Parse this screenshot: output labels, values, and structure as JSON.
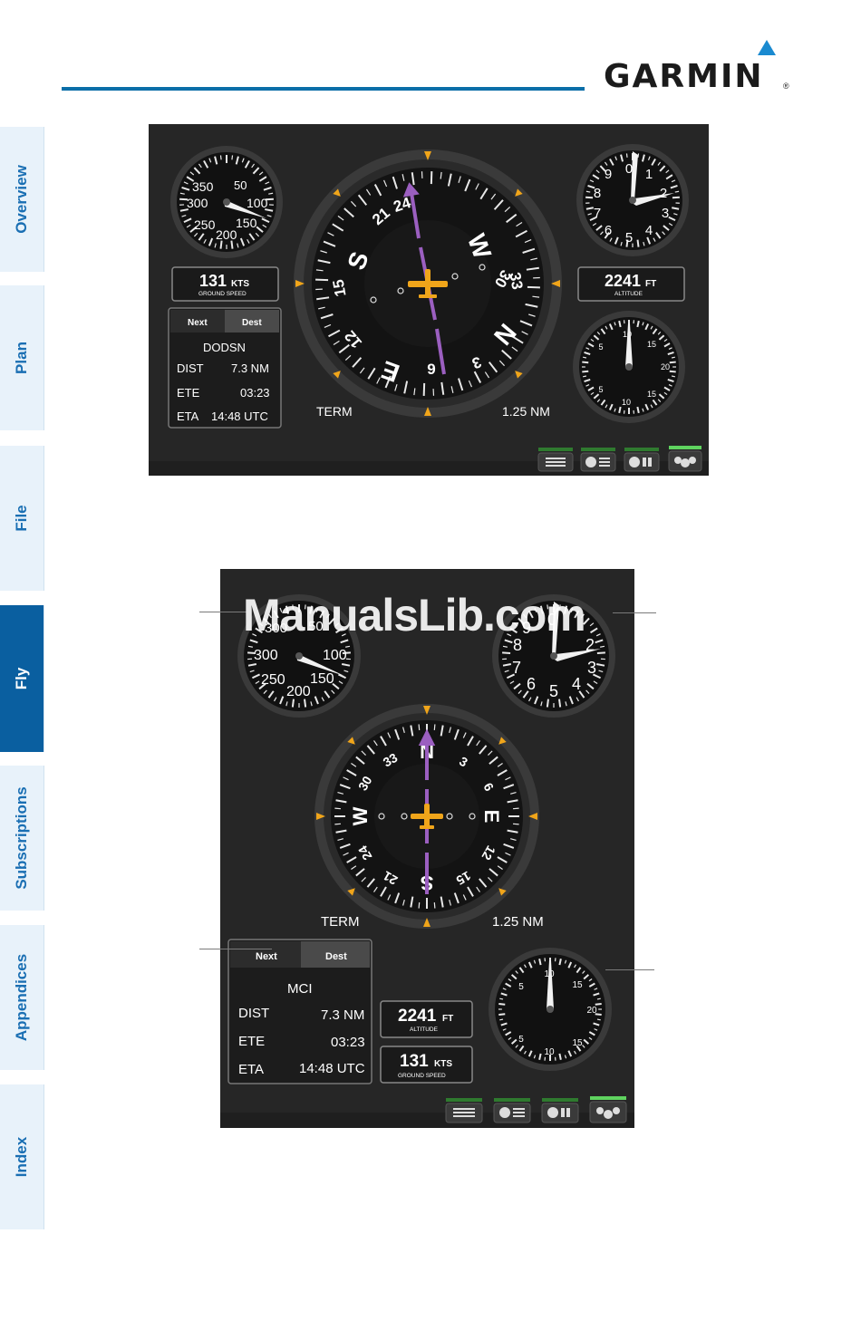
{
  "header": {
    "brand": "GARMIN",
    "reg": "®"
  },
  "tabs": [
    {
      "label": "Overview",
      "active": false
    },
    {
      "label": "Plan",
      "active": false
    },
    {
      "label": "File",
      "active": false
    },
    {
      "label": "Fly",
      "active": true
    },
    {
      "label": "Subscriptions",
      "active": false
    },
    {
      "label": "Appendices",
      "active": false
    },
    {
      "label": "Index",
      "active": false
    }
  ],
  "landscape": {
    "ground_speed": {
      "value": "131",
      "unit": "KTS",
      "label": "GROUND SPEED"
    },
    "altitude": {
      "value": "2241",
      "unit": "FT",
      "label": "ALTITUDE"
    },
    "nav_tabs": {
      "next": "Next",
      "dest": "Dest"
    },
    "waypoint": "DODSN",
    "rows": [
      {
        "label": "DIST",
        "value": "7.3 NM"
      },
      {
        "label": "ETE",
        "value": "03:23"
      },
      {
        "label": "ETA",
        "value": "14:48 UTC"
      }
    ],
    "hsi_mode": "TERM",
    "hsi_range": "1.25 NM",
    "airspeed_ticks": [
      "350",
      "50",
      "300",
      "100",
      "250",
      "150",
      "200"
    ],
    "altimeter_ticks": [
      "0",
      "1",
      "9",
      "2",
      "8",
      "3",
      "7",
      "4",
      "6",
      "5"
    ],
    "hsi_cardinals": [
      "24",
      "W",
      "30",
      "33",
      "N",
      "3",
      "E",
      "9",
      "S",
      "21",
      "15",
      "12"
    ],
    "vsi_ticks": [
      "10",
      "5",
      "15",
      "20",
      "5",
      "10",
      "15"
    ]
  },
  "portrait": {
    "ground_speed": {
      "value": "131",
      "unit": "KTS",
      "label": "GROUND SPEED"
    },
    "altitude": {
      "value": "2241",
      "unit": "FT",
      "label": "ALTITUDE"
    },
    "nav_tabs": {
      "next": "Next",
      "dest": "Dest"
    },
    "waypoint": "MCI",
    "rows": [
      {
        "label": "DIST",
        "value": "7.3 NM"
      },
      {
        "label": "ETE",
        "value": "03:23"
      },
      {
        "label": "ETA",
        "value": "14:48 UTC"
      }
    ],
    "hsi_mode": "TERM",
    "hsi_range": "1.25 NM",
    "airspeed_ticks": [
      "300",
      "50",
      "300",
      "100",
      "250",
      "150",
      "200"
    ],
    "altimeter_ticks": [
      "0",
      "9",
      "8",
      "2",
      "7",
      "3",
      "6",
      "4",
      "5"
    ],
    "hsi_cardinals": [
      "N",
      "3",
      "6",
      "E",
      "12",
      "15",
      "S",
      "21",
      "24",
      "W",
      "30",
      "33"
    ],
    "vsi_ticks": [
      "10",
      "5",
      "15",
      "20",
      "5",
      "10",
      "15"
    ]
  },
  "watermark": "ManualsLib.com",
  "colors": {
    "accent": "#0a6ea8",
    "heading_bug": "#f0a51a",
    "course": "#9b5fc0",
    "active_page_tab": "#5fd35f"
  },
  "icons": [
    "garmin-triangle-icon",
    "airplane-icon",
    "layout-grid-icon",
    "layout-dial-list-icon",
    "layout-dial-grid-icon",
    "layout-dials-icon"
  ]
}
